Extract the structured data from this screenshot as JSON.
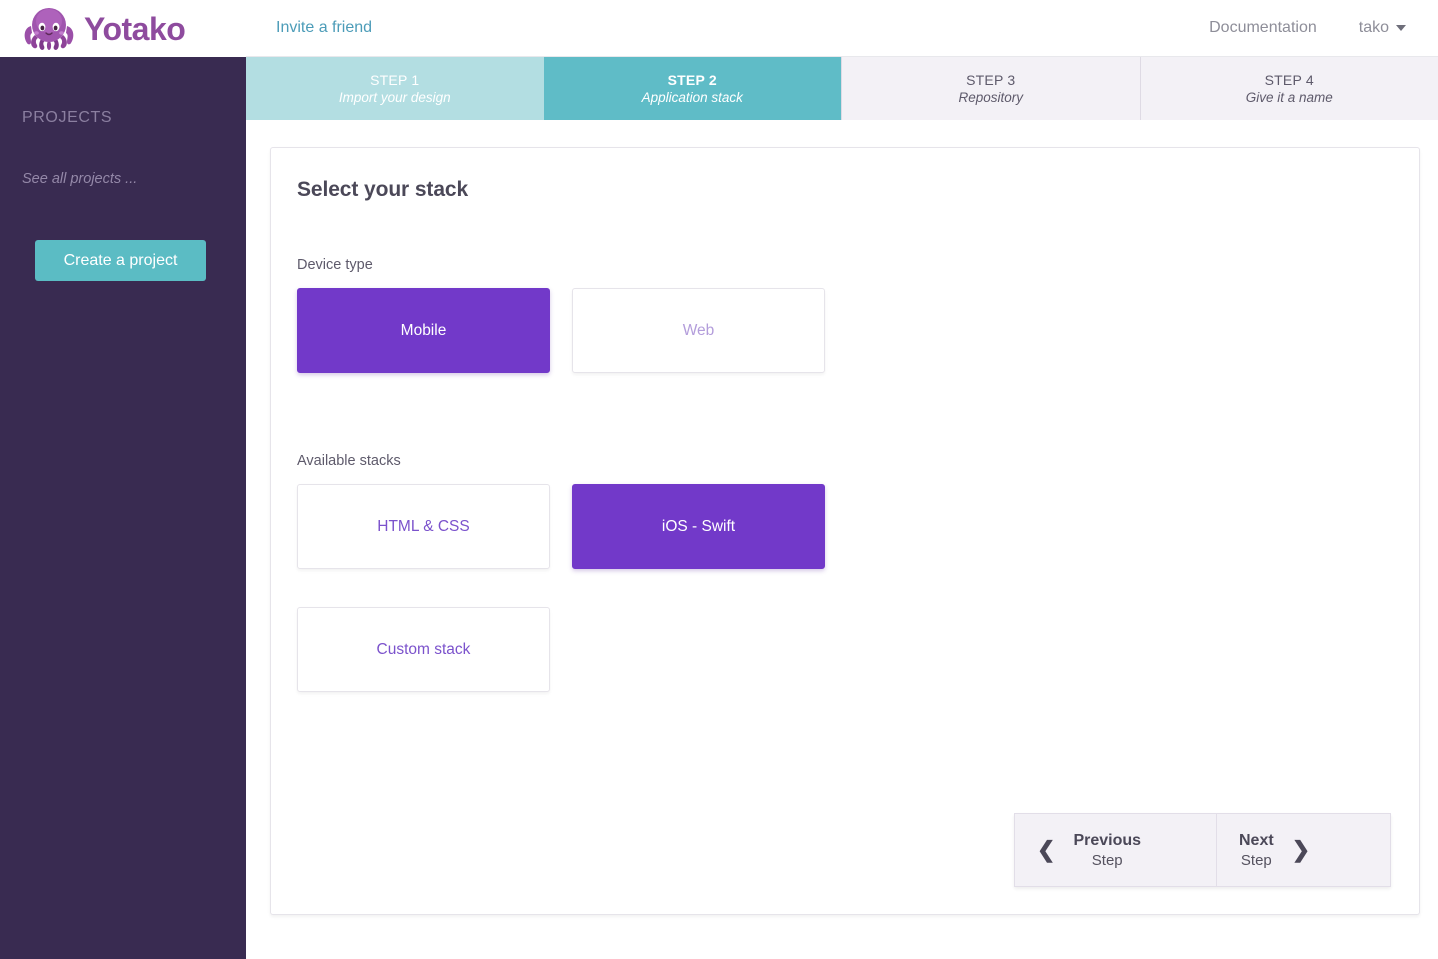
{
  "brand": {
    "name": "Yotako",
    "logo_icon": "octopus-icon",
    "logo_color": "#8E4B9E"
  },
  "topbar": {
    "invite_label": "Invite a friend",
    "documentation_label": "Documentation",
    "user_label": "tako",
    "caret_icon": "chevron-down-icon"
  },
  "sidebar": {
    "projects_label": "PROJECTS",
    "see_all_label": "See all projects ...",
    "create_label": "Create a project",
    "background": "#392B51",
    "button_color": "#5BBCC4"
  },
  "steps": [
    {
      "title": "STEP 1",
      "subtitle": "Import your design",
      "state": "done",
      "color": "#B3DEE2"
    },
    {
      "title": "STEP 2",
      "subtitle": "Application stack",
      "state": "active",
      "color": "#5FBCC7"
    },
    {
      "title": "STEP 3",
      "subtitle": "Repository",
      "state": "todo",
      "color": "#F3F1F6"
    },
    {
      "title": "STEP 4",
      "subtitle": "Give it a name",
      "state": "todo",
      "color": "#F3F1F6"
    }
  ],
  "card": {
    "title": "Select your stack",
    "device_type_label": "Device type",
    "available_stacks_label": "Available stacks",
    "accent_selected": "#7239C9",
    "accent_text": "#7B52CC",
    "accent_muted": "#B39DDB"
  },
  "device_types": [
    {
      "label": "Mobile",
      "state": "selected"
    },
    {
      "label": "Web",
      "state": "muted"
    }
  ],
  "stacks": [
    {
      "label": "HTML & CSS",
      "state": "unselected"
    },
    {
      "label": "iOS - Swift",
      "state": "selected"
    },
    {
      "label": "Custom stack",
      "state": "unselected"
    }
  ],
  "nav": {
    "previous_main": "Previous",
    "previous_sub": "Step",
    "next_main": "Next",
    "next_sub": "Step",
    "prev_icon": "chevron-left-icon",
    "next_icon": "chevron-right-icon"
  }
}
